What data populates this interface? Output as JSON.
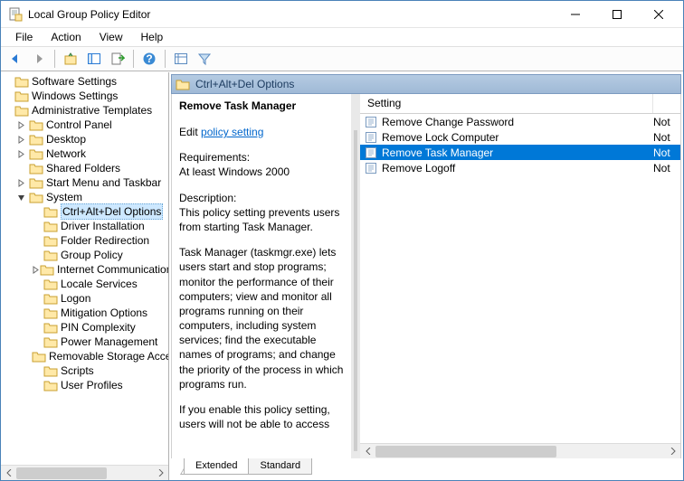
{
  "window": {
    "title": "Local Group Policy Editor"
  },
  "menu": {
    "items": [
      "File",
      "Action",
      "View",
      "Help"
    ]
  },
  "tree": {
    "roots": [
      {
        "label": "Software Settings",
        "indent": 0,
        "expander": ""
      },
      {
        "label": "Windows Settings",
        "indent": 0,
        "expander": ""
      },
      {
        "label": "Administrative Templates",
        "indent": 0,
        "expander": ""
      },
      {
        "label": "Control Panel",
        "indent": 1,
        "expander": ">"
      },
      {
        "label": "Desktop",
        "indent": 1,
        "expander": ">"
      },
      {
        "label": "Network",
        "indent": 1,
        "expander": ">"
      },
      {
        "label": "Shared Folders",
        "indent": 1,
        "expander": ""
      },
      {
        "label": "Start Menu and Taskbar",
        "indent": 1,
        "expander": ">"
      },
      {
        "label": "System",
        "indent": 1,
        "expander": "v"
      },
      {
        "label": "Ctrl+Alt+Del Options",
        "indent": 2,
        "expander": "",
        "selected": true
      },
      {
        "label": "Driver Installation",
        "indent": 2,
        "expander": ""
      },
      {
        "label": "Folder Redirection",
        "indent": 2,
        "expander": ""
      },
      {
        "label": "Group Policy",
        "indent": 2,
        "expander": ""
      },
      {
        "label": "Internet Communication Management",
        "indent": 2,
        "expander": ">"
      },
      {
        "label": "Locale Services",
        "indent": 2,
        "expander": ""
      },
      {
        "label": "Logon",
        "indent": 2,
        "expander": ""
      },
      {
        "label": "Mitigation Options",
        "indent": 2,
        "expander": ""
      },
      {
        "label": "PIN Complexity",
        "indent": 2,
        "expander": ""
      },
      {
        "label": "Power Management",
        "indent": 2,
        "expander": ""
      },
      {
        "label": "Removable Storage Access",
        "indent": 2,
        "expander": ""
      },
      {
        "label": "Scripts",
        "indent": 2,
        "expander": ""
      },
      {
        "label": "User Profiles",
        "indent": 2,
        "expander": ""
      }
    ]
  },
  "header": {
    "title": "Ctrl+Alt+Del Options"
  },
  "description": {
    "title": "Remove Task Manager",
    "edit_prefix": "Edit ",
    "edit_link": "policy setting ",
    "requirements_label": "Requirements:",
    "requirements_value": "At least Windows 2000",
    "desc_label": "Description:",
    "para1": "This policy setting prevents users from starting Task Manager.",
    "para2": "Task Manager (taskmgr.exe) lets users start and stop programs; monitor the performance of their computers; view and monitor all programs running on their computers, including system services; find the executable names of programs; and change the priority of the process in which programs run.",
    "para3": "If you enable this policy setting, users will not be able to access"
  },
  "settings": {
    "col_name": "Setting",
    "rows": [
      {
        "label": "Remove Change Password",
        "state": "Not",
        "selected": false
      },
      {
        "label": "Remove Lock Computer",
        "state": "Not",
        "selected": false
      },
      {
        "label": "Remove Task Manager",
        "state": "Not",
        "selected": true
      },
      {
        "label": "Remove Logoff",
        "state": "Not",
        "selected": false
      }
    ]
  },
  "tabs": {
    "extended": "Extended",
    "standard": "Standard"
  }
}
